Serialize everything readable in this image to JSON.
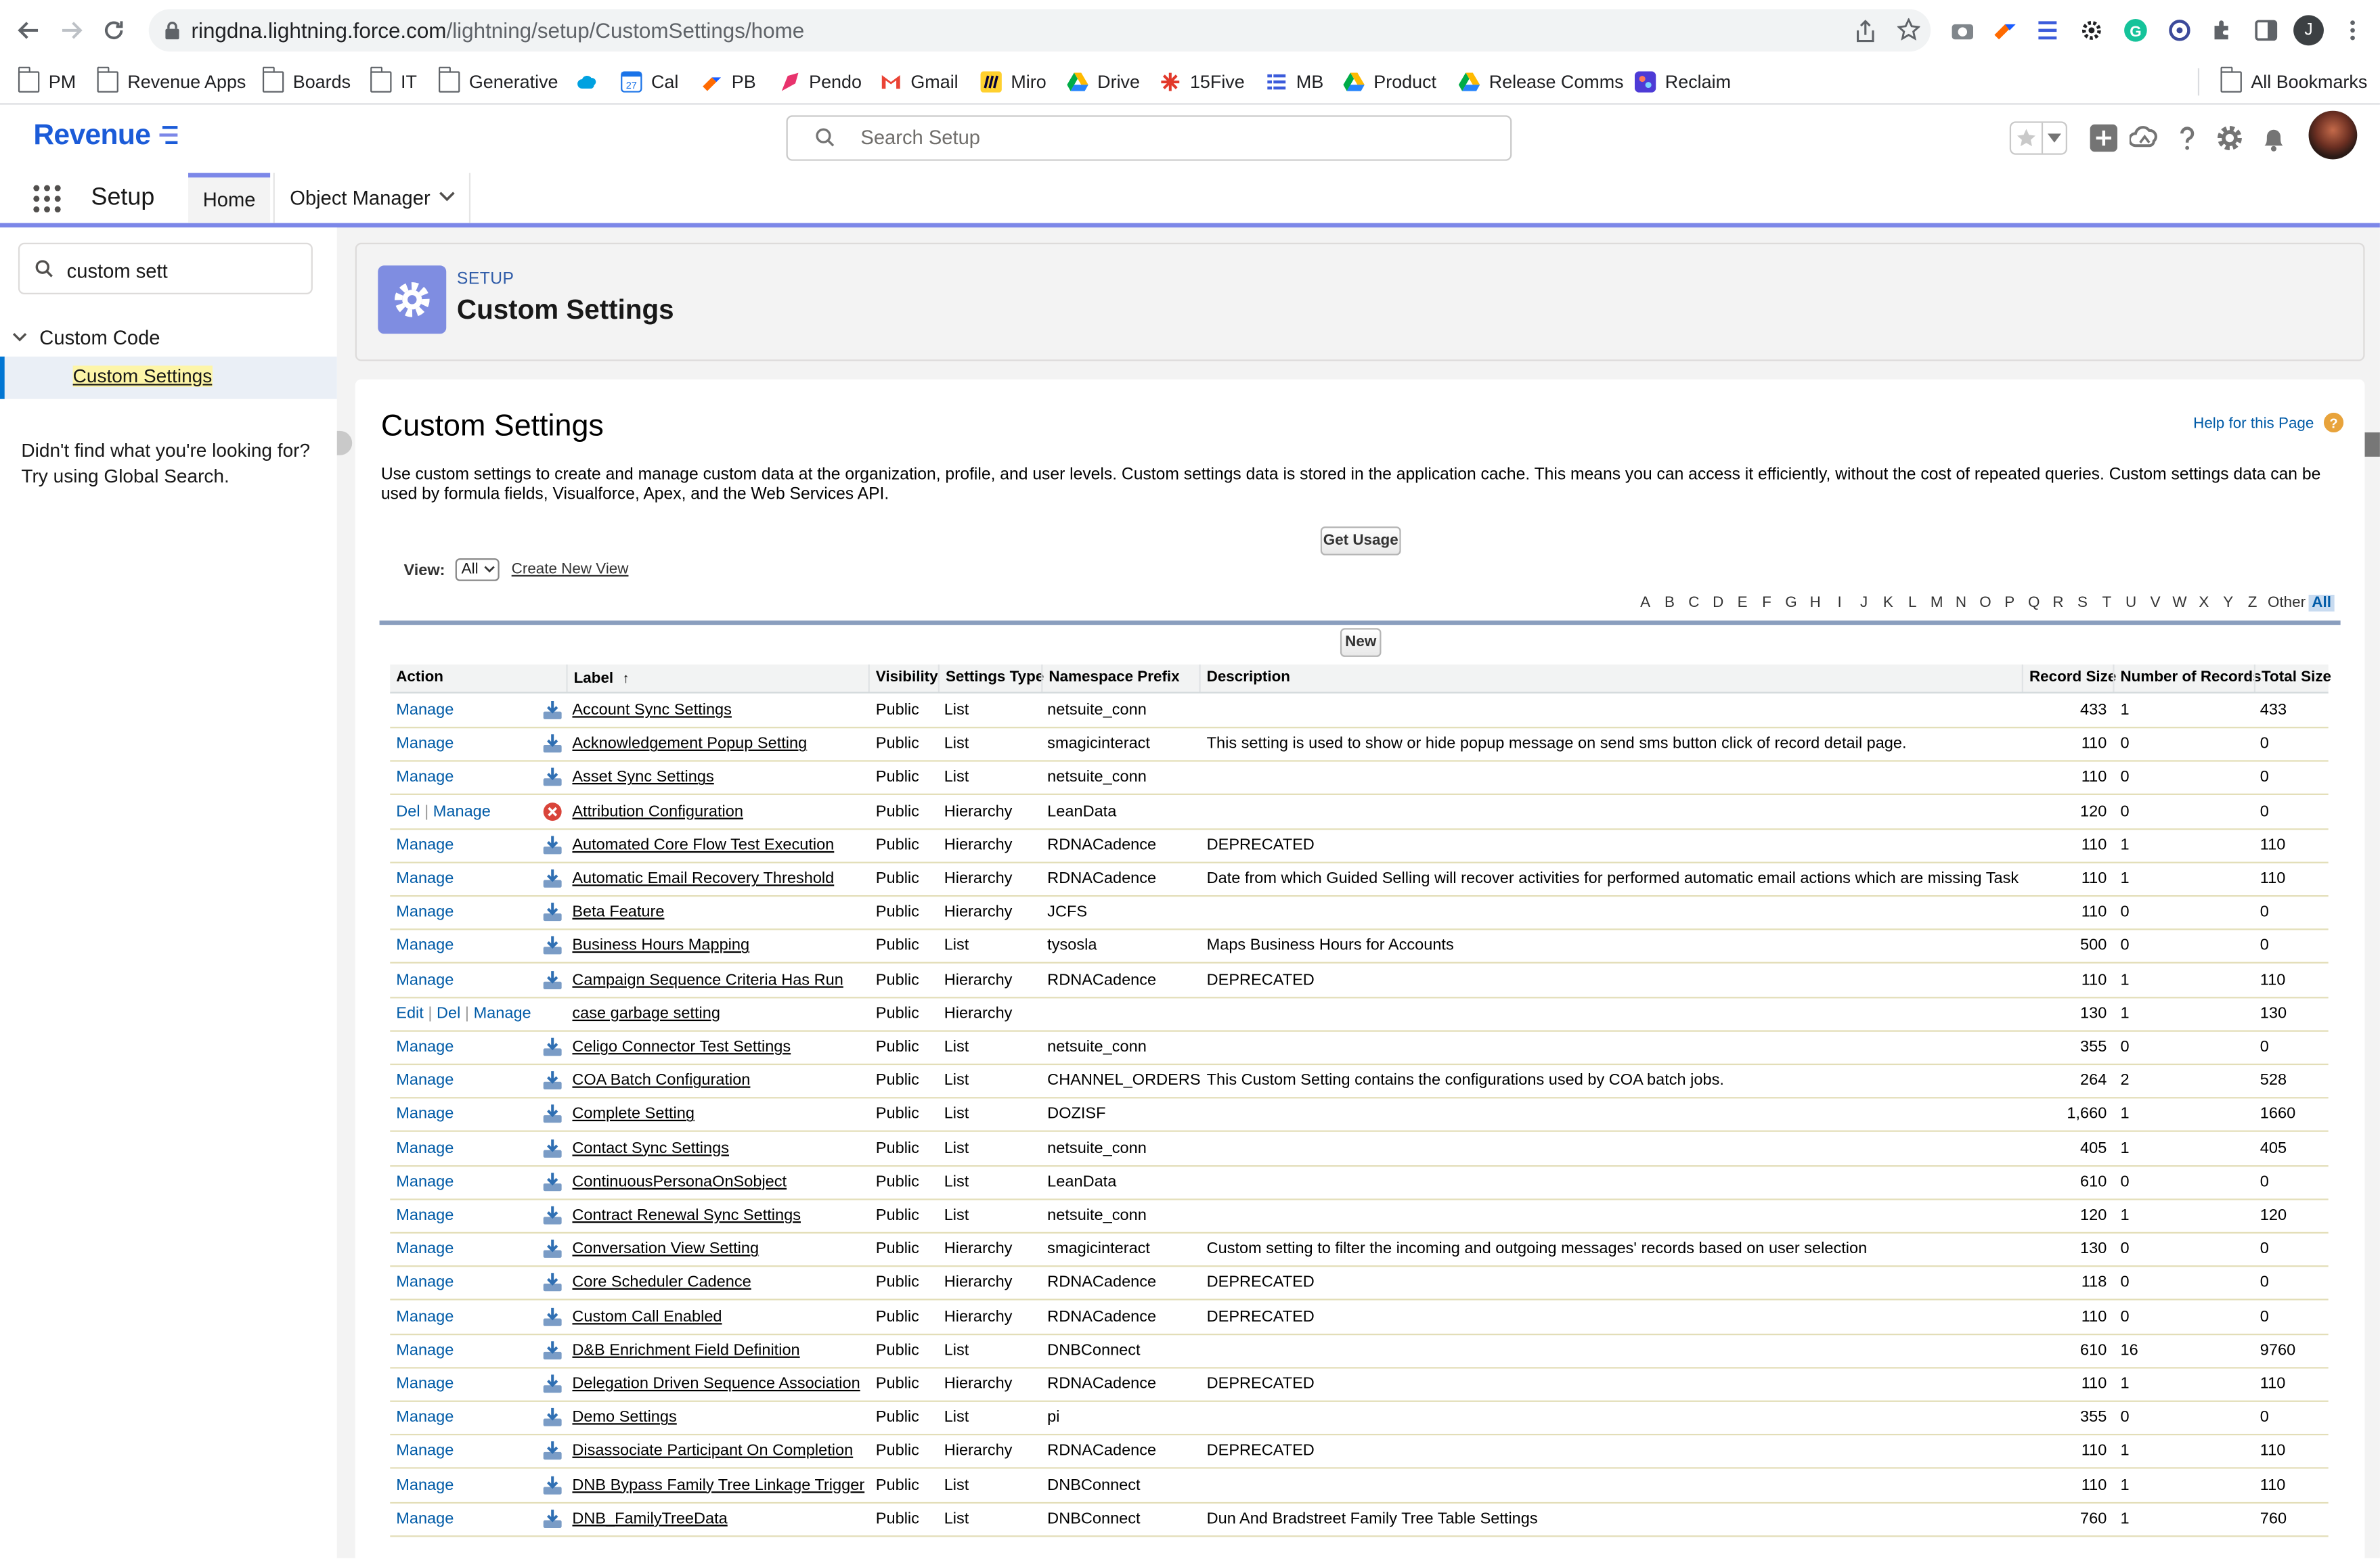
{
  "browser": {
    "url_domain": "ringdna.lightning.force.com",
    "url_path": "/lightning/setup/CustomSettings/home",
    "avatar_letter": "J"
  },
  "bookmarks": [
    {
      "label": "PM",
      "type": "folder"
    },
    {
      "label": "Revenue Apps",
      "type": "folder"
    },
    {
      "label": "Boards",
      "type": "folder"
    },
    {
      "label": "IT",
      "type": "folder"
    },
    {
      "label": "Generative",
      "type": "folder"
    },
    {
      "label": "",
      "type": "salesforce"
    },
    {
      "label": "Cal",
      "type": "calendar"
    },
    {
      "label": "PB",
      "type": "pb"
    },
    {
      "label": "Pendo",
      "type": "pendo"
    },
    {
      "label": "Gmail",
      "type": "gmail"
    },
    {
      "label": "Miro",
      "type": "miro"
    },
    {
      "label": "Drive",
      "type": "drive"
    },
    {
      "label": "15Five",
      "type": "fifteen"
    },
    {
      "label": "MB",
      "type": "mb"
    },
    {
      "label": "Product",
      "type": "drive"
    },
    {
      "label": "Release Comms",
      "type": "drive"
    },
    {
      "label": "Reclaim",
      "type": "reclaim"
    }
  ],
  "all_bookmarks_label": "All Bookmarks",
  "header": {
    "logo_text": "Revenue",
    "search_placeholder": "Search Setup"
  },
  "context_bar": {
    "app_name": "Setup",
    "tabs": [
      {
        "label": "Home"
      },
      {
        "label": "Object Manager"
      }
    ]
  },
  "sidebar": {
    "quick_find_value": "custom sett",
    "section_label": "Custom Code",
    "item_label": "Custom Settings",
    "not_found_line1": "Didn't find what you're looking for?",
    "not_found_line2": "Try using Global Search."
  },
  "page_header": {
    "eyebrow": "SETUP",
    "title": "Custom Settings"
  },
  "main": {
    "title": "Custom Settings",
    "help_link": "Help for this Page",
    "description": "Use custom settings to create and manage custom data at the organization, profile, and user levels. Custom settings data is stored in the application cache. This means you can access it efficiently, without the cost of repeated queries. Custom settings data can be used by formula fields, Visualforce, Apex, and the Web Services API.",
    "get_usage_label": "Get Usage",
    "view_label": "View:",
    "view_selected": "All",
    "create_view_label": "Create New View",
    "new_button_label": "New",
    "alphabet": [
      "A",
      "B",
      "C",
      "D",
      "E",
      "F",
      "G",
      "H",
      "I",
      "J",
      "K",
      "L",
      "M",
      "N",
      "O",
      "P",
      "Q",
      "R",
      "S",
      "T",
      "U",
      "V",
      "W",
      "X",
      "Y",
      "Z",
      "Other",
      "All"
    ],
    "columns": [
      "Action",
      "Label",
      "Visibility",
      "Settings Type",
      "Namespace Prefix",
      "Description",
      "Record Size",
      "Number of Records",
      "Total Size"
    ],
    "sort_indicator": "↑",
    "rows": [
      {
        "actions": [
          "Manage"
        ],
        "icon": "download",
        "label": "Account Sync Settings",
        "visibility": "Public",
        "type": "List",
        "ns": "netsuite_conn",
        "desc": "",
        "record_size": "433",
        "num_records": "1",
        "total": "433"
      },
      {
        "actions": [
          "Manage"
        ],
        "icon": "download",
        "label": "Acknowledgement Popup Setting",
        "visibility": "Public",
        "type": "List",
        "ns": "smagicinteract",
        "desc": "This setting is used to show or hide popup message on send sms button click of record detail page.",
        "record_size": "110",
        "num_records": "0",
        "total": "0"
      },
      {
        "actions": [
          "Manage"
        ],
        "icon": "download",
        "label": "Asset Sync Settings",
        "visibility": "Public",
        "type": "List",
        "ns": "netsuite_conn",
        "desc": "",
        "record_size": "110",
        "num_records": "0",
        "total": "0"
      },
      {
        "actions": [
          "Del",
          "Manage"
        ],
        "icon": "error",
        "label": "Attribution Configuration",
        "visibility": "Public",
        "type": "Hierarchy",
        "ns": "LeanData",
        "desc": "",
        "record_size": "120",
        "num_records": "0",
        "total": "0"
      },
      {
        "actions": [
          "Manage"
        ],
        "icon": "download",
        "label": "Automated Core Flow Test Execution",
        "visibility": "Public",
        "type": "Hierarchy",
        "ns": "RDNACadence",
        "desc": "DEPRECATED",
        "record_size": "110",
        "num_records": "1",
        "total": "110"
      },
      {
        "actions": [
          "Manage"
        ],
        "icon": "download",
        "label": "Automatic Email Recovery Threshold",
        "visibility": "Public",
        "type": "Hierarchy",
        "ns": "RDNACadence",
        "desc": "Date from which Guided Selling will recover activities for performed automatic email actions which are missing Tasks.",
        "record_size": "110",
        "num_records": "1",
        "total": "110"
      },
      {
        "actions": [
          "Manage"
        ],
        "icon": "download",
        "label": "Beta Feature",
        "visibility": "Public",
        "type": "Hierarchy",
        "ns": "JCFS",
        "desc": "",
        "record_size": "110",
        "num_records": "0",
        "total": "0"
      },
      {
        "actions": [
          "Manage"
        ],
        "icon": "download",
        "label": "Business Hours Mapping",
        "visibility": "Public",
        "type": "List",
        "ns": "tysosla",
        "desc": "Maps Business Hours for Accounts",
        "record_size": "500",
        "num_records": "0",
        "total": "0"
      },
      {
        "actions": [
          "Manage"
        ],
        "icon": "download",
        "label": "Campaign Sequence Criteria Has Run",
        "visibility": "Public",
        "type": "Hierarchy",
        "ns": "RDNACadence",
        "desc": "DEPRECATED",
        "record_size": "110",
        "num_records": "1",
        "total": "110"
      },
      {
        "actions": [
          "Edit",
          "Del",
          "Manage"
        ],
        "icon": "",
        "label": "case garbage setting",
        "visibility": "Public",
        "type": "Hierarchy",
        "ns": "",
        "desc": "",
        "record_size": "130",
        "num_records": "1",
        "total": "130"
      },
      {
        "actions": [
          "Manage"
        ],
        "icon": "download",
        "label": "Celigo Connector Test Settings",
        "visibility": "Public",
        "type": "List",
        "ns": "netsuite_conn",
        "desc": "",
        "record_size": "355",
        "num_records": "0",
        "total": "0"
      },
      {
        "actions": [
          "Manage"
        ],
        "icon": "download",
        "label": "COA Batch Configuration",
        "visibility": "Public",
        "type": "List",
        "ns": "CHANNEL_ORDERS",
        "desc": "This Custom Setting contains the configurations used by COA batch jobs.",
        "record_size": "264",
        "num_records": "2",
        "total": "528"
      },
      {
        "actions": [
          "Manage"
        ],
        "icon": "download",
        "label": "Complete Setting",
        "visibility": "Public",
        "type": "List",
        "ns": "DOZISF",
        "desc": "",
        "record_size": "1,660",
        "num_records": "1",
        "total": "1660"
      },
      {
        "actions": [
          "Manage"
        ],
        "icon": "download",
        "label": "Contact Sync Settings",
        "visibility": "Public",
        "type": "List",
        "ns": "netsuite_conn",
        "desc": "",
        "record_size": "405",
        "num_records": "1",
        "total": "405"
      },
      {
        "actions": [
          "Manage"
        ],
        "icon": "download",
        "label": "ContinuousPersonaOnSobject",
        "visibility": "Public",
        "type": "List",
        "ns": "LeanData",
        "desc": "",
        "record_size": "610",
        "num_records": "0",
        "total": "0"
      },
      {
        "actions": [
          "Manage"
        ],
        "icon": "download",
        "label": "Contract Renewal Sync Settings",
        "visibility": "Public",
        "type": "List",
        "ns": "netsuite_conn",
        "desc": "",
        "record_size": "120",
        "num_records": "1",
        "total": "120"
      },
      {
        "actions": [
          "Manage"
        ],
        "icon": "download",
        "label": "Conversation View Setting",
        "visibility": "Public",
        "type": "Hierarchy",
        "ns": "smagicinteract",
        "desc": "Custom setting to filter the incoming and outgoing messages' records based on user selection",
        "record_size": "130",
        "num_records": "0",
        "total": "0"
      },
      {
        "actions": [
          "Manage"
        ],
        "icon": "download",
        "label": "Core Scheduler Cadence",
        "visibility": "Public",
        "type": "Hierarchy",
        "ns": "RDNACadence",
        "desc": "DEPRECATED",
        "record_size": "118",
        "num_records": "0",
        "total": "0"
      },
      {
        "actions": [
          "Manage"
        ],
        "icon": "download",
        "label": "Custom Call Enabled",
        "visibility": "Public",
        "type": "Hierarchy",
        "ns": "RDNACadence",
        "desc": "DEPRECATED",
        "record_size": "110",
        "num_records": "0",
        "total": "0"
      },
      {
        "actions": [
          "Manage"
        ],
        "icon": "download",
        "label": "D&B Enrichment Field Definition",
        "visibility": "Public",
        "type": "List",
        "ns": "DNBConnect",
        "desc": "",
        "record_size": "610",
        "num_records": "16",
        "total": "9760"
      },
      {
        "actions": [
          "Manage"
        ],
        "icon": "download",
        "label": "Delegation Driven Sequence Association",
        "visibility": "Public",
        "type": "Hierarchy",
        "ns": "RDNACadence",
        "desc": "DEPRECATED",
        "record_size": "110",
        "num_records": "1",
        "total": "110"
      },
      {
        "actions": [
          "Manage"
        ],
        "icon": "download",
        "label": "Demo Settings",
        "visibility": "Public",
        "type": "List",
        "ns": "pi",
        "desc": "",
        "record_size": "355",
        "num_records": "0",
        "total": "0"
      },
      {
        "actions": [
          "Manage"
        ],
        "icon": "download",
        "label": "Disassociate Participant On Completion",
        "visibility": "Public",
        "type": "Hierarchy",
        "ns": "RDNACadence",
        "desc": "DEPRECATED",
        "record_size": "110",
        "num_records": "1",
        "total": "110"
      },
      {
        "actions": [
          "Manage"
        ],
        "icon": "download",
        "label": "DNB Bypass Family Tree Linkage Trigger",
        "visibility": "Public",
        "type": "List",
        "ns": "DNBConnect",
        "desc": "",
        "record_size": "110",
        "num_records": "1",
        "total": "110"
      },
      {
        "actions": [
          "Manage"
        ],
        "icon": "download",
        "label": "DNB_FamilyTreeData",
        "visibility": "Public",
        "type": "List",
        "ns": "DNBConnect",
        "desc": "Dun And Bradstreet Family Tree Table Settings",
        "record_size": "760",
        "num_records": "1",
        "total": "760"
      }
    ]
  },
  "colors": {
    "accent": "#7c87e8",
    "link": "#015ba7",
    "brand": "#1b5bd8",
    "gear_tile": "#7f8de1"
  }
}
